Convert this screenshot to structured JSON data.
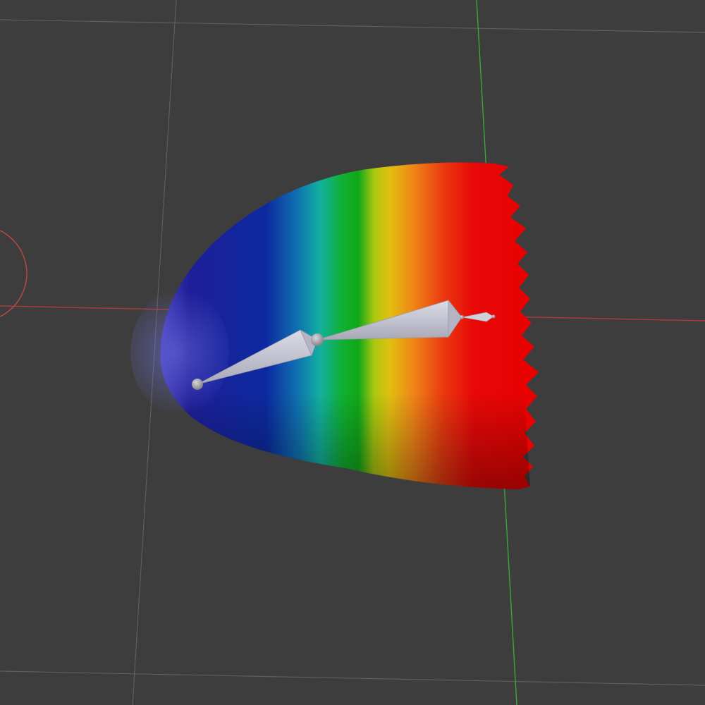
{
  "viewport": {
    "background": "#3d3d3d",
    "grid_color": "#5a5a5a",
    "x_axis_color": "#b03a3a",
    "y_axis_color": "#3aa63a"
  },
  "weight_paint": {
    "gradient_colors": [
      "#4a44c0",
      "#141a90",
      "#0a3aa8",
      "#10a8b0",
      "#10b020",
      "#d8d010",
      "#f08010",
      "#e81010",
      "#e80000"
    ]
  },
  "armature": {
    "bone_color": "#c8c8d8",
    "joint_color": "#9a9aa0",
    "bone_count": 3
  },
  "icons": {
    "object_origin_circle": "object-origin-circle-icon"
  }
}
